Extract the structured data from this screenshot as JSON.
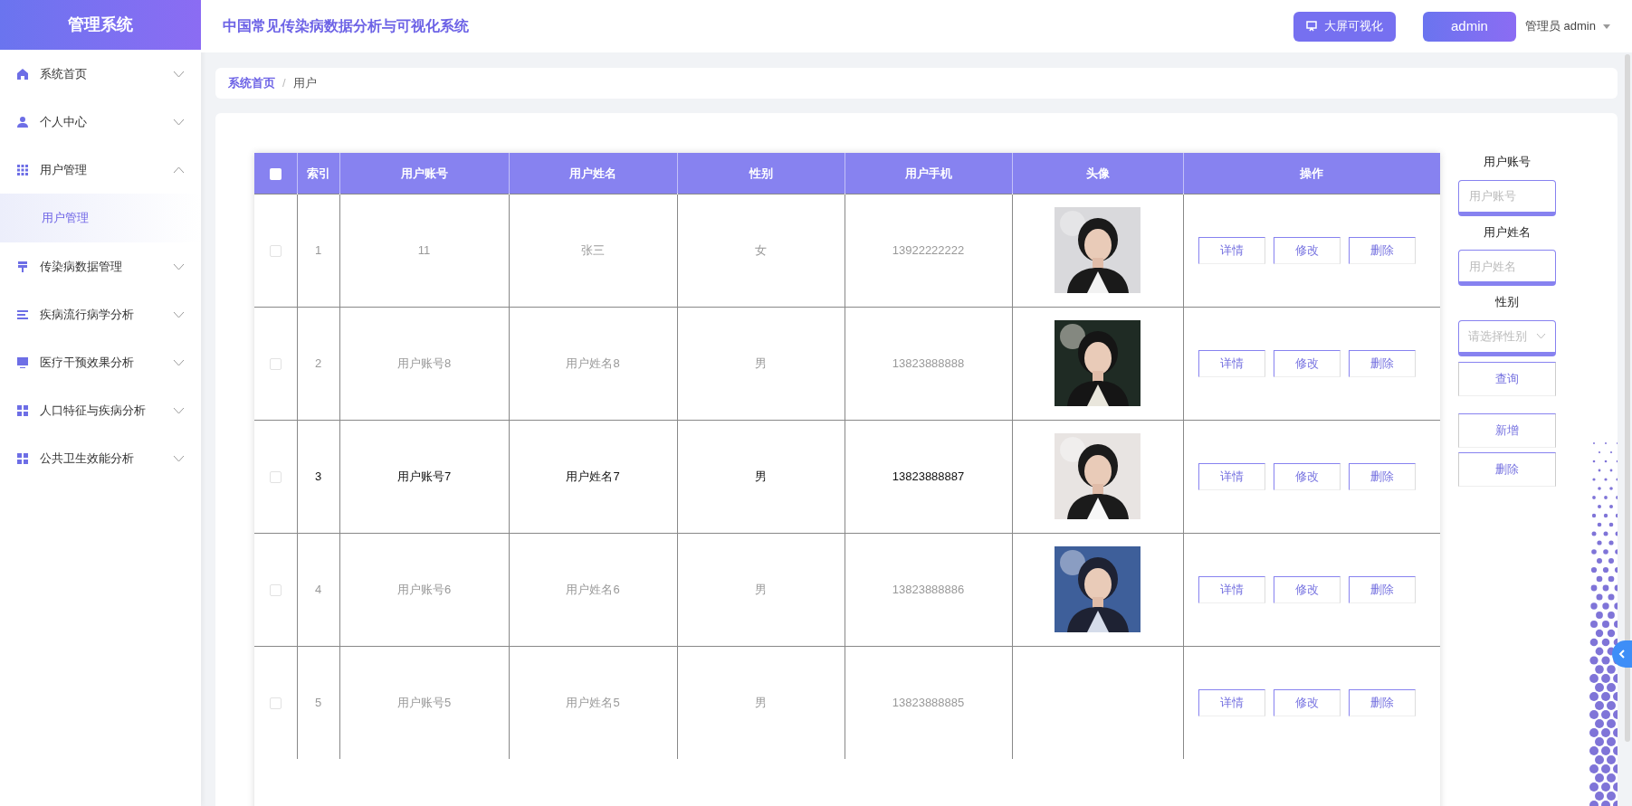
{
  "sidebar": {
    "title": "管理系统",
    "items": [
      {
        "label": "系统首页",
        "expanded": false
      },
      {
        "label": "个人中心",
        "expanded": false
      },
      {
        "label": "用户管理",
        "expanded": true,
        "children": [
          {
            "label": "用户管理",
            "selected": true
          }
        ]
      },
      {
        "label": "传染病数据管理",
        "expanded": false
      },
      {
        "label": "疾病流行病学分析",
        "expanded": false
      },
      {
        "label": "医疗干预效果分析",
        "expanded": false
      },
      {
        "label": "人口特征与疾病分析",
        "expanded": false
      },
      {
        "label": "公共卫生效能分析",
        "expanded": false
      }
    ]
  },
  "header": {
    "title": "中国常见传染病数据分析与可视化系统",
    "screen_button": "大屏可视化",
    "user_button": "admin",
    "user_menu": "管理员 admin"
  },
  "breadcrumb": [
    "系统首页",
    "用户"
  ],
  "breadcrumb_separator": "/",
  "table": {
    "columns": [
      "索引",
      "用户账号",
      "用户姓名",
      "性别",
      "用户手机",
      "头像",
      "操作"
    ],
    "header_checked": false,
    "rows": [
      {
        "checked": false,
        "hovered": false,
        "cells": [
          "1",
          "11",
          "张三",
          "女",
          "13922222222"
        ],
        "actions": [
          "详情",
          "修改",
          "删除"
        ]
      },
      {
        "checked": false,
        "hovered": false,
        "cells": [
          "2",
          "用户账号8",
          "用户姓名8",
          "男",
          "13823888888"
        ],
        "actions": [
          "详情",
          "修改",
          "删除"
        ]
      },
      {
        "checked": false,
        "hovered": true,
        "cells": [
          "3",
          "用户账号7",
          "用户姓名7",
          "男",
          "13823888887"
        ],
        "actions": [
          "详情",
          "修改",
          "删除"
        ]
      },
      {
        "checked": false,
        "hovered": false,
        "cells": [
          "4",
          "用户账号6",
          "用户姓名6",
          "男",
          "13823888886"
        ],
        "actions": [
          "详情",
          "修改",
          "删除"
        ]
      },
      {
        "checked": false,
        "hovered": false,
        "cells": [
          "5",
          "用户账号5",
          "用户姓名5",
          "男",
          "13823888885"
        ],
        "actions": [
          "详情",
          "修改",
          "删除"
        ]
      }
    ]
  },
  "search": {
    "fields": [
      {
        "kind": "text",
        "label": "用户账号",
        "placeholder": "用户账号"
      },
      {
        "kind": "text",
        "label": "用户姓名",
        "placeholder": "用户姓名"
      },
      {
        "kind": "select",
        "label": "性别",
        "placeholder": "请选择性别"
      }
    ],
    "buttons": [
      "查询",
      "新增",
      "删除"
    ]
  }
}
